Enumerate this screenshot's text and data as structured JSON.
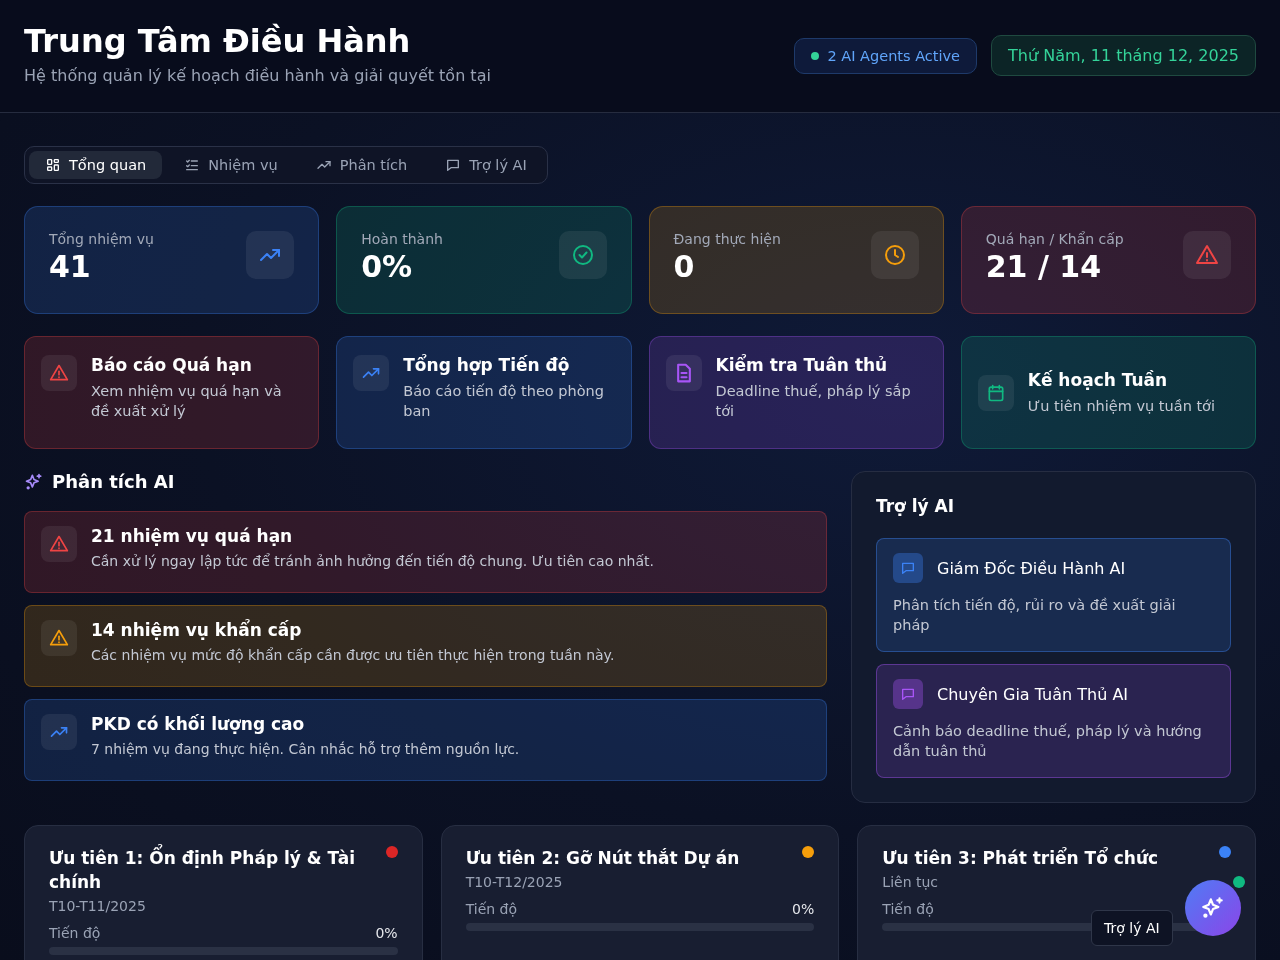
{
  "header": {
    "title": "Trung Tâm Điều Hành",
    "subtitle": "Hệ thống quản lý kế hoạch điều hành và giải quyết tồn tại",
    "agents_badge": {
      "text": "2 AI Agents Active",
      "live": true
    },
    "date": "Thứ Năm, 11 tháng 12, 2025"
  },
  "tabs": [
    {
      "label": "Tổng quan",
      "selected": true
    },
    {
      "label": "Nhiệm vụ",
      "selected": false
    },
    {
      "label": "Phân tích",
      "selected": false
    },
    {
      "label": "Trợ lý AI",
      "selected": false
    }
  ],
  "stats": [
    {
      "label": "Tổng nhiệm vụ",
      "value": "41",
      "color": "#3b82f6"
    },
    {
      "label": "Hoàn thành",
      "value": "0%",
      "color": "#10b981"
    },
    {
      "label": "Đang thực hiện",
      "value": "0",
      "color": "#f59e0b"
    },
    {
      "label": "Quá hạn / Khẩn cấp",
      "value": "21 / 14",
      "color": "#ef4444"
    }
  ],
  "quick_actions": [
    {
      "title": "Báo cáo Quá hạn",
      "description": "Xem nhiệm vụ quá hạn và đề xuất xử lý",
      "color": "#ef4444"
    },
    {
      "title": "Tổng hợp Tiến độ",
      "description": "Báo cáo tiến độ theo phòng ban",
      "color": "#3b82f6"
    },
    {
      "title": "Kiểm tra Tuân thủ",
      "description": "Deadline thuế, pháp lý sắp tới",
      "color": "#a855f7"
    },
    {
      "title": "Kế hoạch Tuần",
      "description": "Ưu tiên nhiệm vụ tuần tới",
      "color": "#10b981"
    }
  ],
  "analysis": {
    "title": "Phân tích AI",
    "items": [
      {
        "title": "21 nhiệm vụ quá hạn",
        "description": "Cần xử lý ngay lập tức để tránh ảnh hưởng đến tiến độ chung. Ưu tiên cao nhất.",
        "color": "#ef4444"
      },
      {
        "title": "14 nhiệm vụ khẩn cấp",
        "description": "Các nhiệm vụ mức độ khẩn cấp cần được ưu tiên thực hiện trong tuần này.",
        "color": "#f59e0b"
      },
      {
        "title": "PKD có khối lượng cao",
        "description": "7 nhiệm vụ đang thực hiện. Cân nhắc hỗ trợ thêm nguồn lực.",
        "color": "#3b82f6"
      }
    ]
  },
  "assistant": {
    "title": "Trợ lý AI",
    "agents": [
      {
        "name": "Giám Đốc Điều Hành AI",
        "description": "Phân tích tiến độ, rủi ro và đề xuất giải pháp",
        "color": "#3b82f6"
      },
      {
        "name": "Chuyên Gia Tuân Thủ AI",
        "description": "Cảnh báo deadline thuế, pháp lý và hướng dẫn tuân thủ",
        "color": "#a855f7"
      }
    ]
  },
  "priorities": [
    {
      "title": "Ưu tiên 1: Ổn định Pháp lý & Tài chính",
      "period": "T10-T11/2025",
      "progress_label": "Tiến độ",
      "progress_value": "0%",
      "level": 0,
      "color": "#dc2626"
    },
    {
      "title": "Ưu tiên 2: Gỡ Nút thắt Dự án",
      "period": "T10-T12/2025",
      "progress_label": "Tiến độ",
      "progress_value": "0%",
      "level": 0,
      "color": "#f59e0b"
    },
    {
      "title": "Ưu tiên 3: Phát triển Tổ chức",
      "period": "Liên tục",
      "progress_label": "Tiến độ",
      "level": 0,
      "color": "#3b82f6"
    }
  ],
  "fab": {
    "tooltip": "Trợ lý AI",
    "online": true
  }
}
